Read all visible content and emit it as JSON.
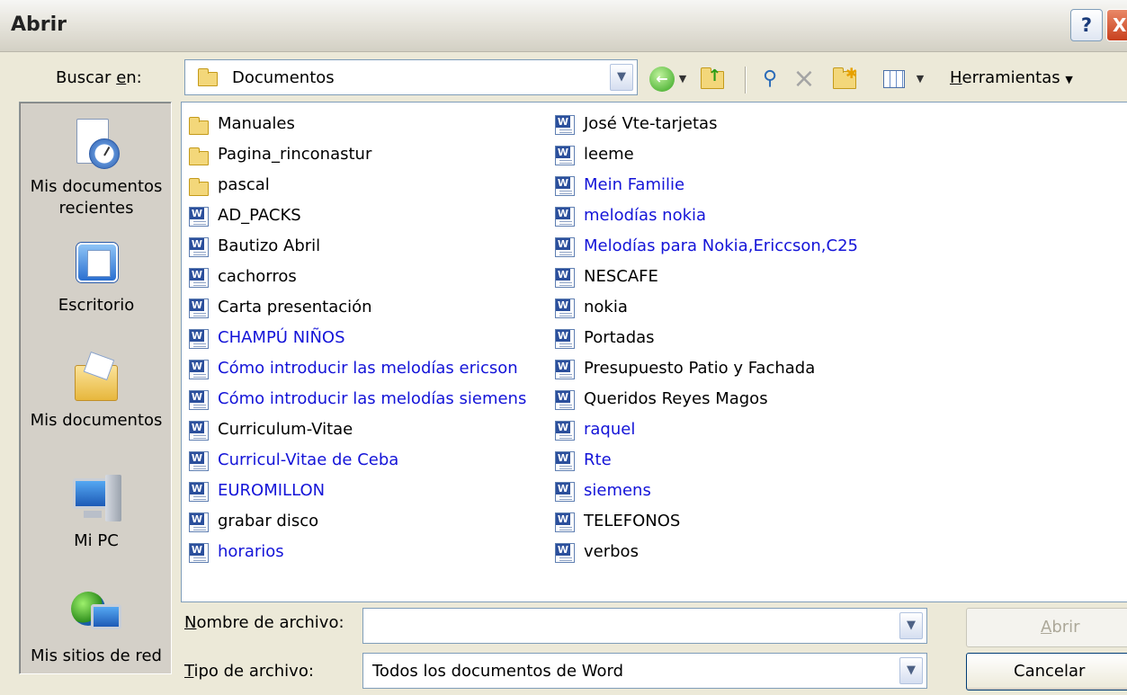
{
  "window": {
    "title": "Abrir",
    "help_label": "?",
    "close_label": "X"
  },
  "lookin": {
    "label_pre": "Buscar ",
    "label_u": "e",
    "label_post": "n:",
    "value": "Documentos"
  },
  "toolbar": {
    "tools_pre": "",
    "tools_u": "H",
    "tools_post": "erramientas"
  },
  "places": [
    {
      "label1": "Mis documentos",
      "label2": "recientes",
      "icon": "recent-documents-icon"
    },
    {
      "label1": "Escritorio",
      "label2": "",
      "icon": "desktop-icon"
    },
    {
      "label1": "Mis documentos",
      "label2": "",
      "icon": "my-documents-icon"
    },
    {
      "label1": "Mi PC",
      "label2": "",
      "icon": "my-computer-icon"
    },
    {
      "label1": "Mis sitios de red",
      "label2": "",
      "icon": "network-places-icon"
    }
  ],
  "files_col1": [
    {
      "name": "Manuales",
      "type": "folder",
      "link": false
    },
    {
      "name": "Pagina_rinconastur",
      "type": "folder",
      "link": false
    },
    {
      "name": "pascal",
      "type": "folder",
      "link": false
    },
    {
      "name": "AD_PACKS",
      "type": "word",
      "link": false
    },
    {
      "name": "Bautizo Abril",
      "type": "word",
      "link": false
    },
    {
      "name": "cachorros",
      "type": "word",
      "link": false
    },
    {
      "name": "Carta presentación",
      "type": "word",
      "link": false
    },
    {
      "name": "CHAMPÚ  NIÑOS",
      "type": "word",
      "link": true
    },
    {
      "name": "Cómo introducir las melodías ericson",
      "type": "word",
      "link": true
    },
    {
      "name": "Cómo introducir las melodías siemens",
      "type": "word",
      "link": true
    },
    {
      "name": "Curriculum-Vitae",
      "type": "word",
      "link": false
    },
    {
      "name": "Curricul-Vitae de Ceba",
      "type": "word",
      "link": true
    },
    {
      "name": "EUROMILLON",
      "type": "word",
      "link": true
    },
    {
      "name": "grabar disco",
      "type": "word",
      "link": false
    },
    {
      "name": "horarios",
      "type": "word",
      "link": true
    }
  ],
  "files_col2": [
    {
      "name": "José Vte-tarjetas",
      "type": "word",
      "link": false
    },
    {
      "name": "leeme",
      "type": "word",
      "link": false
    },
    {
      "name": "Mein Familie",
      "type": "word",
      "link": true
    },
    {
      "name": "melodías nokia",
      "type": "word",
      "link": true
    },
    {
      "name": "Melodías para Nokia,Ericcson,C25",
      "type": "word",
      "link": true
    },
    {
      "name": "NESCAFE",
      "type": "word",
      "link": false
    },
    {
      "name": "nokia",
      "type": "word",
      "link": false
    },
    {
      "name": "Portadas",
      "type": "word",
      "link": false
    },
    {
      "name": "Presupuesto Patio y Fachada",
      "type": "word",
      "link": false
    },
    {
      "name": "Queridos Reyes Magos",
      "type": "word",
      "link": false
    },
    {
      "name": "raquel",
      "type": "word",
      "link": true
    },
    {
      "name": "Rte",
      "type": "word",
      "link": true
    },
    {
      "name": "siemens",
      "type": "word",
      "link": true
    },
    {
      "name": "TELEFONOS",
      "type": "word",
      "link": false
    },
    {
      "name": "verbos",
      "type": "word",
      "link": false
    }
  ],
  "filename": {
    "label_u": "N",
    "label_post": "ombre de archivo:",
    "value": ""
  },
  "filetype": {
    "label_u": "T",
    "label_post": "ipo de archivo:",
    "value": "Todos los documentos de Word"
  },
  "buttons": {
    "open_u": "A",
    "open_post": "brir",
    "cancel": "Cancelar"
  },
  "colors": {
    "link": "#1414d8",
    "dialog_bg": "#ECE9D8",
    "border": "#7f9db9"
  }
}
